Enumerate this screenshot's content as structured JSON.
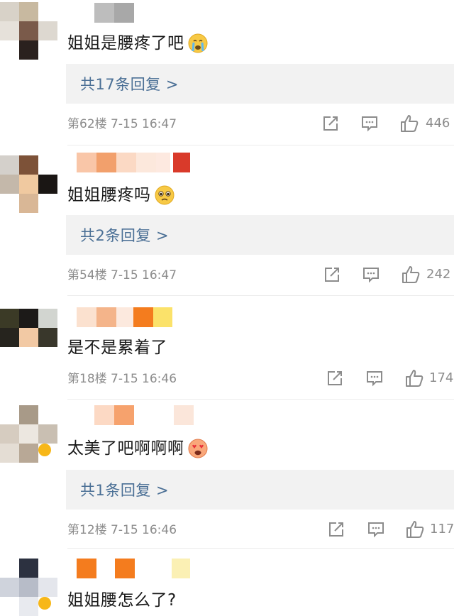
{
  "comments": [
    {
      "text": "姐姐是腰疼了吧",
      "emoji": "crying-face",
      "reply_label": "共17条回复 >",
      "floor": "第62楼",
      "time": "7-15 16:47",
      "likes": "446"
    },
    {
      "text": "姐姐腰疼吗",
      "emoji": "pleading-face",
      "reply_label": "共2条回复 >",
      "floor": "第54楼",
      "time": "7-15 16:47",
      "likes": "242"
    },
    {
      "text": "是不是累着了",
      "emoji": "",
      "reply_label": "",
      "floor": "第18楼",
      "time": "7-15 16:46",
      "likes": "174"
    },
    {
      "text": "太美了吧啊啊啊",
      "emoji": "heart-eyes-face",
      "reply_label": "共1条回复 >",
      "floor": "第12楼",
      "time": "7-15 16:46",
      "likes": "117"
    },
    {
      "text": "姐姐腰怎么了?",
      "emoji": "",
      "reply_label": "",
      "floor": "",
      "time": "",
      "likes": ""
    }
  ],
  "icons": {
    "share": "share-icon",
    "comment": "comment-icon",
    "like": "thumbs-up-icon"
  },
  "colors": {
    "reply_link": "#4a6f95",
    "meta_text": "#8c8c8c",
    "reply_bg": "#f2f2f2"
  }
}
